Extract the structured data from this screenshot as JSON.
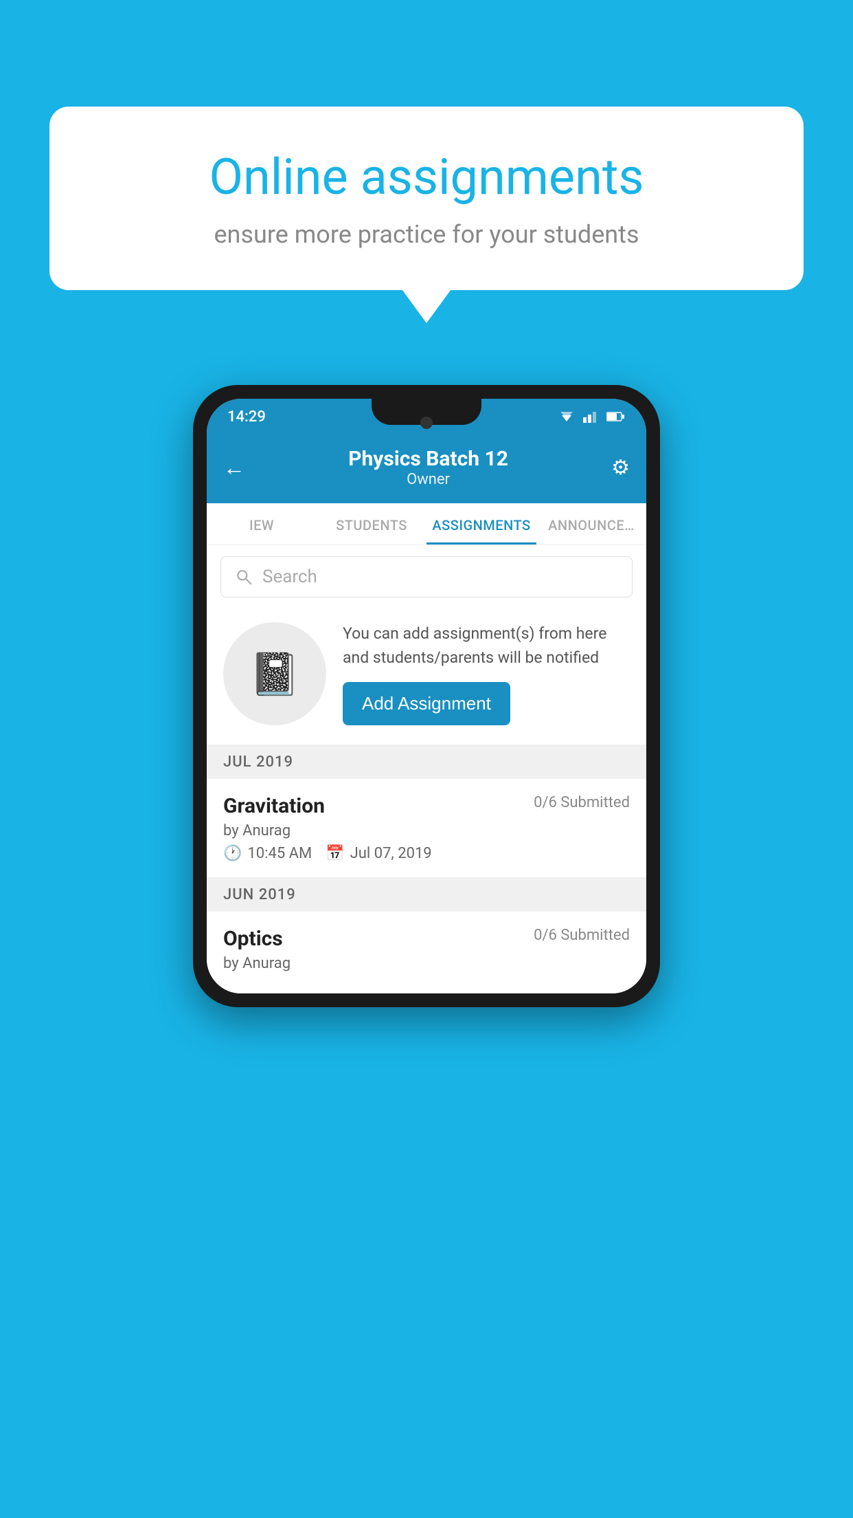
{
  "background_color": "#19b3e6",
  "speech_bubble": {
    "title": "Online assignments",
    "subtitle": "ensure more practice for your students"
  },
  "phone": {
    "status_bar": {
      "time": "14:29"
    },
    "header": {
      "title": "Physics Batch 12",
      "subtitle": "Owner",
      "back_label": "←",
      "settings_label": "⚙"
    },
    "tabs": [
      {
        "label": "IEW",
        "active": false
      },
      {
        "label": "STUDENTS",
        "active": false
      },
      {
        "label": "ASSIGNMENTS",
        "active": true
      },
      {
        "label": "ANNOUNCEMENTS",
        "active": false
      }
    ],
    "search": {
      "placeholder": "Search"
    },
    "promo": {
      "text": "You can add assignment(s) from here and students/parents will be notified",
      "button_label": "Add Assignment"
    },
    "sections": [
      {
        "month": "JUL 2019",
        "assignments": [
          {
            "name": "Gravitation",
            "submitted": "0/6 Submitted",
            "author": "by Anurag",
            "time": "10:45 AM",
            "date": "Jul 07, 2019"
          }
        ]
      },
      {
        "month": "JUN 2019",
        "assignments": [
          {
            "name": "Optics",
            "submitted": "0/6 Submitted",
            "author": "by Anurag",
            "time": "",
            "date": ""
          }
        ]
      }
    ]
  }
}
